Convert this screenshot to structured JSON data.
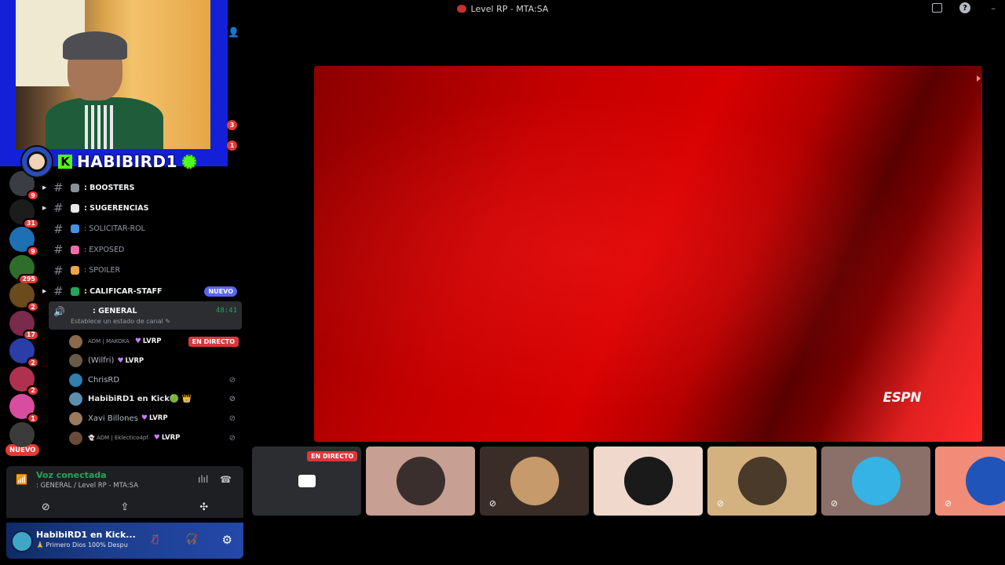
{
  "window": {
    "title": "Level RP - MTA:SA",
    "controls": {
      "inbox": "inbox-icon",
      "help": "?",
      "minimize": "–"
    }
  },
  "webcam": {
    "handle": "HABIBIRD1",
    "kick_letter": "K"
  },
  "side_badges": [
    "3",
    "1"
  ],
  "servers": [
    {
      "badge": "9",
      "color": "#3a3d43"
    },
    {
      "badge": "31",
      "color": "#1c1c1c"
    },
    {
      "badge": "9",
      "color": "#1f6fb4"
    },
    {
      "badge": "295",
      "color": "#2f6e2a"
    },
    {
      "badge": "2",
      "color": "#6b4a1d"
    },
    {
      "badge": "17",
      "color": "#7a2a4a"
    },
    {
      "badge": "2",
      "color": "#2b3ea8"
    },
    {
      "badge": "2",
      "color": "#b0304f"
    },
    {
      "badge": "1",
      "color": "#d94da0"
    },
    {
      "badge": "",
      "color": "#3b3b3b"
    }
  ],
  "servers_new_label": "NUEVO",
  "channels": [
    {
      "name": ": BOOSTERS",
      "arrow": "▶",
      "emoji_color": "#8a8f99",
      "muted": false
    },
    {
      "name": ": SUGERENCIAS",
      "arrow": "▶",
      "emoji_color": "#e8e8e8",
      "muted": false
    },
    {
      "name": ": SOLICITAR-ROL",
      "arrow": "",
      "emoji_color": "#4a90e2",
      "muted": true
    },
    {
      "name": ": EXPOSED",
      "arrow": "",
      "emoji_color": "#f06ba8",
      "muted": true
    },
    {
      "name": ": SPOILER",
      "arrow": "",
      "emoji_color": "#f2a24a",
      "muted": true
    },
    {
      "name": ": CALIFICAR-STAFF",
      "arrow": "▶",
      "emoji_color": "#23a55a",
      "muted": false,
      "pill": "NUEVO"
    }
  ],
  "voice_channel": {
    "name": ": GENERAL",
    "timer": "48:41",
    "status": "Establece un estado de canal ✎"
  },
  "members": [
    {
      "tag": "ADM | MAKOKA",
      "name": "",
      "lvrp": "LVRP",
      "live": "EN DIRECTO",
      "color": "#8a6a4a"
    },
    {
      "tag": "",
      "name": "(Wilfri)",
      "lvrp": "LVRP",
      "live": "",
      "color": "#6a5a4a"
    },
    {
      "tag": "",
      "name": "ChrisRD",
      "lvrp": "",
      "live": "",
      "color": "#2f7fb0"
    },
    {
      "tag": "",
      "name": "HabibiRD1 en Kick🟢 👑",
      "lvrp": "",
      "live": "",
      "color": "#5a8fb0"
    },
    {
      "tag": "",
      "name": "Xavi Billones",
      "lvrp": "LVRP",
      "live": "",
      "color": "#9a7a5a"
    },
    {
      "tag": "👻 ADM | Eklectico4pf",
      "name": "",
      "lvrp": "LVRP",
      "live": "",
      "color": "#6a4a3a"
    }
  ],
  "voice_connected": {
    "title": "Voz conectada",
    "subtitle": ": GENERAL / Level RP - MTA:SA"
  },
  "user_panel": {
    "name": "HabibiRD1 en Kick...",
    "status": "🙏 Primero Dios 100% Despu"
  },
  "stage": {
    "logo": "ESPN"
  },
  "tiles": [
    {
      "live": "EN DIRECTO",
      "bg": "#2b2d31",
      "pic": "#c8c8c8",
      "mic": false,
      "screen": true
    },
    {
      "live": "",
      "bg": "#c79f93",
      "pic": "#3a2f2d",
      "mic": false
    },
    {
      "live": "",
      "bg": "#3a2d27",
      "pic": "#c69a6a",
      "mic": true
    },
    {
      "live": "",
      "bg": "#f1d8cd",
      "pic": "#1a1a1a",
      "mic": false
    },
    {
      "live": "",
      "bg": "#d4b280",
      "pic": "#4a3a2a",
      "mic": true
    },
    {
      "live": "",
      "bg": "#8a7068",
      "pic": "#34b3e4",
      "mic": true
    },
    {
      "live": "",
      "bg": "#f08c78",
      "pic": "#2154b8",
      "mic": true
    }
  ]
}
